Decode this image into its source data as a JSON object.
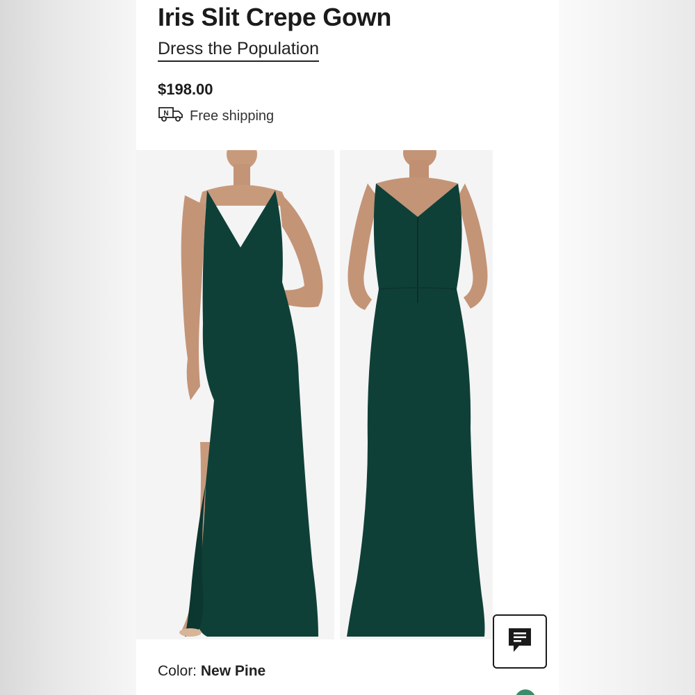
{
  "product": {
    "title": "Iris Slit Crepe Gown",
    "brand": "Dress the Population",
    "price": "$198.00",
    "shipping_label": "Free shipping",
    "shipping_icon_letter": "N",
    "color_label": "Color:",
    "color_value": "New Pine"
  },
  "gallery": {
    "images": [
      {
        "name": "front-view",
        "dress_color": "#0f4038"
      },
      {
        "name": "back-view",
        "dress_color": "#0f4038"
      }
    ]
  },
  "icons": {
    "shipping": "delivery-truck-icon",
    "chat": "chat-bubble-icon"
  },
  "colors": {
    "text": "#1b1b1b",
    "dress": "#0f4038",
    "fab": "#3c8b6c"
  }
}
